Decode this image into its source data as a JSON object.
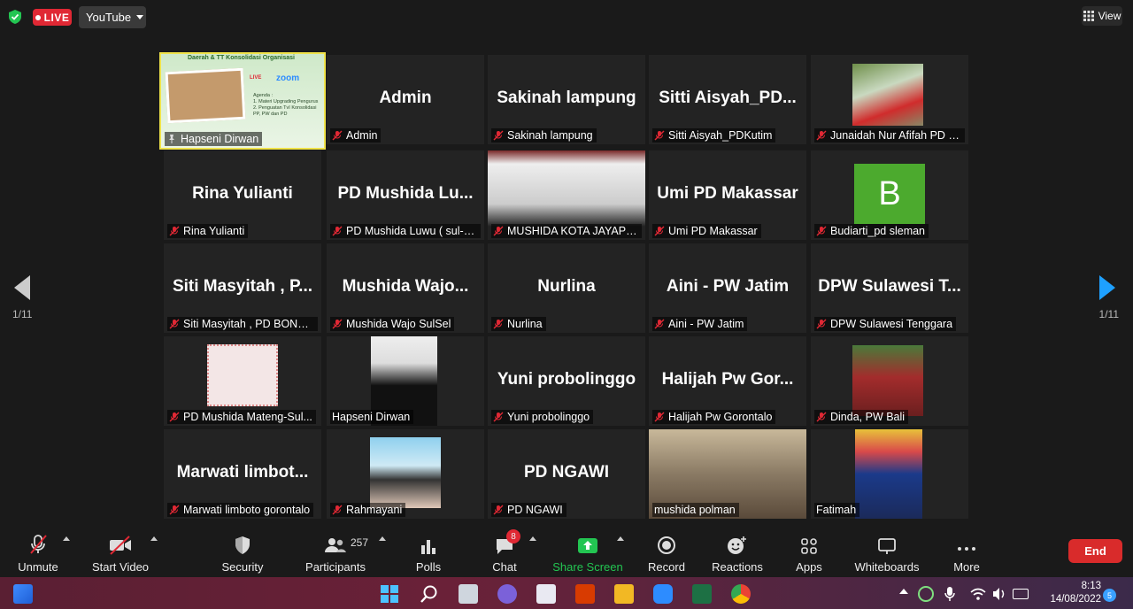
{
  "topbar": {
    "live_label": "LIVE",
    "stream_target": "YouTube",
    "view_label": "View"
  },
  "pagination": {
    "left": "1/11",
    "right": "1/11"
  },
  "tiles": [
    {
      "name": "Hapseni Dirwan",
      "display": "",
      "active": true,
      "muted": false,
      "kind": "slide",
      "slide_title": "Daerah & TT Konsolidasi Organisasi",
      "slide_live": "LIVE",
      "slide_zoom": "zoom",
      "slide_agenda": "Agenda :",
      "slide_items": [
        "1. Materi Upgrading Pengurus",
        "2. Penguatan TvI Konsolidasi PP, PW dan PD"
      ]
    },
    {
      "name": "Admin",
      "display": "Admin",
      "muted": true,
      "kind": "text"
    },
    {
      "name": "Sakinah lampung",
      "display": "Sakinah lampung",
      "muted": true,
      "kind": "text"
    },
    {
      "name": "Sitti Aisyah_PDKutim",
      "display": "Sitti Aisyah_PD...",
      "muted": true,
      "kind": "text"
    },
    {
      "name": "Junaidah Nur Afifah PD B...",
      "display": "",
      "muted": true,
      "kind": "photo"
    },
    {
      "name": "Rina Yulianti",
      "display": "Rina Yulianti",
      "muted": true,
      "kind": "text"
    },
    {
      "name": "PD Mushida Luwu ( sul-s...",
      "display": "PD Mushida Lu...",
      "muted": true,
      "kind": "text"
    },
    {
      "name": "MUSHIDA KOTA JAYAPUR...",
      "display": "",
      "muted": true,
      "kind": "video"
    },
    {
      "name": "Umi PD Makassar",
      "display": "Umi PD Makassar",
      "muted": true,
      "kind": "text"
    },
    {
      "name": "Budiarti_pd sleman",
      "display": "",
      "muted": true,
      "kind": "avatar",
      "avatar_letter": "B"
    },
    {
      "name": "Siti Masyitah , PD BONTA...",
      "display": "Siti Masyitah , P...",
      "muted": true,
      "kind": "text"
    },
    {
      "name": "Mushida Wajo SulSel",
      "display": "Mushida Wajo...",
      "muted": true,
      "kind": "text"
    },
    {
      "name": "Nurlina",
      "display": "Nurlina",
      "muted": true,
      "kind": "text"
    },
    {
      "name": "Aini - PW Jatim",
      "display": "Aini - PW Jatim",
      "muted": true,
      "kind": "text"
    },
    {
      "name": "DPW Sulawesi Tenggara",
      "display": "DPW Sulawesi T...",
      "muted": true,
      "kind": "text"
    },
    {
      "name": "PD Mushida Mateng-Sul...",
      "display": "",
      "muted": true,
      "kind": "card"
    },
    {
      "name": "Hapseni Dirwan",
      "display": "",
      "muted": false,
      "kind": "photo"
    },
    {
      "name": "Yuni probolinggo",
      "display": "Yuni probolinggo",
      "muted": true,
      "kind": "text"
    },
    {
      "name": "Halijah  Pw Gorontalo",
      "display": "Halijah  Pw Gor...",
      "muted": true,
      "kind": "text"
    },
    {
      "name": "Dinda, PW Bali",
      "display": "",
      "muted": true,
      "kind": "photo"
    },
    {
      "name": "Marwati limboto gorontalo",
      "display": "Marwati  limbot...",
      "muted": true,
      "kind": "text"
    },
    {
      "name": "Rahmayani",
      "display": "",
      "muted": true,
      "kind": "photo"
    },
    {
      "name": "PD NGAWI",
      "display": "PD NGAWI",
      "muted": true,
      "kind": "text"
    },
    {
      "name": "mushida polman",
      "display": "",
      "muted": false,
      "kind": "video"
    },
    {
      "name": "Fatimah",
      "display": "",
      "muted": false,
      "kind": "video"
    }
  ],
  "toolbar": {
    "unmute": "Unmute",
    "start_video": "Start Video",
    "security": "Security",
    "participants": "Participants",
    "participants_count": "257",
    "polls": "Polls",
    "chat": "Chat",
    "chat_badge": "8",
    "share": "Share Screen",
    "record": "Record",
    "reactions": "Reactions",
    "apps": "Apps",
    "whiteboards": "Whiteboards",
    "more": "More",
    "end": "End"
  },
  "taskbar": {
    "time": "8:13",
    "date": "14/08/2022",
    "notifications": "5"
  },
  "colors": {
    "accent": "#f0e34a",
    "live": "#e02834",
    "share": "#23c552",
    "end": "#d92b2b",
    "next_arrow": "#1ea0ff"
  }
}
